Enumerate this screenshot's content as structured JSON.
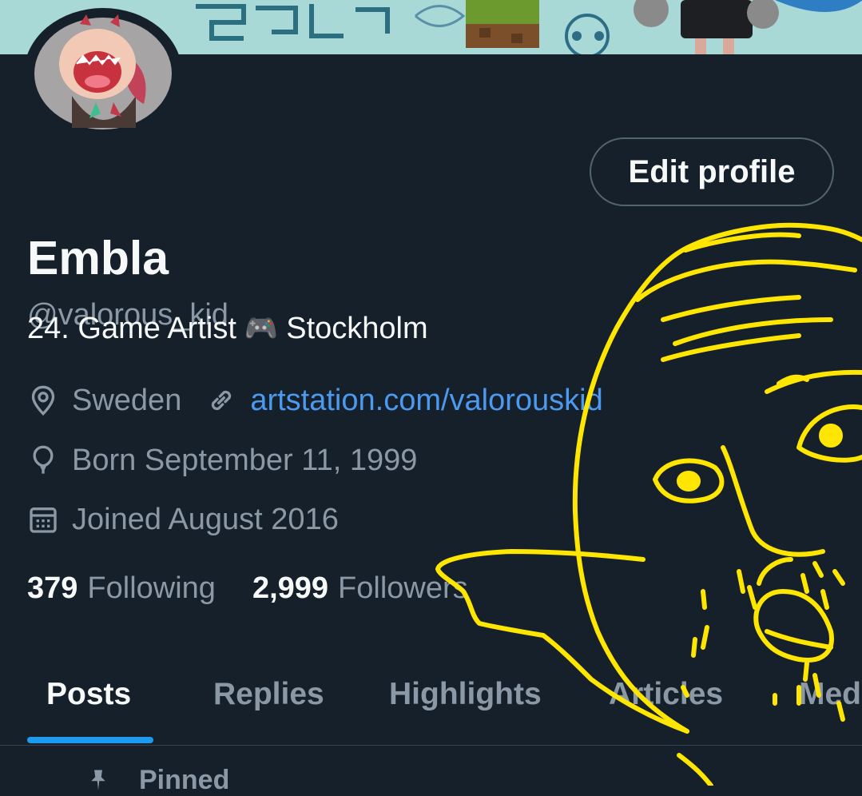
{
  "profile": {
    "display_name": "Embla",
    "handle": "@valorous_kid",
    "edit_label": "Edit profile",
    "bio_prefix": "24. Game Artist",
    "bio_emoji": "🎮",
    "bio_suffix": "Stockholm",
    "location": "Sweden",
    "website": "artstation.com/valorouskid",
    "birthday": "Born September 11, 1999",
    "joined": "Joined August 2016"
  },
  "stats": {
    "following_count": "379",
    "following_label": "Following",
    "followers_count": "2,999",
    "followers_label": "Followers"
  },
  "tabs": [
    {
      "label": "Posts",
      "active": true
    },
    {
      "label": "Replies",
      "active": false
    },
    {
      "label": "Highlights",
      "active": false
    },
    {
      "label": "Articles",
      "active": false
    },
    {
      "label": "Media",
      "active": false
    }
  ],
  "pinned": {
    "label": "Pinned"
  },
  "colors": {
    "background": "#15202b",
    "text_primary": "#f7f9f9",
    "text_secondary": "#8b98a5",
    "link": "#4c9aef",
    "accent": "#1d9bf0",
    "drawing": "#ffe600"
  },
  "icons": [
    "location-pin-icon",
    "link-icon",
    "birthday-balloon-icon",
    "calendar-icon",
    "pin-icon",
    "game-controller-icon"
  ]
}
